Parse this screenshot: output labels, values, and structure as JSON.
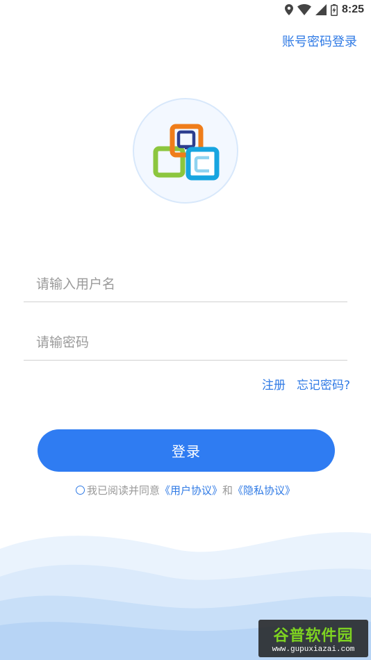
{
  "status_bar": {
    "time": "8:25",
    "icons": [
      "location-icon",
      "wifi-icon",
      "signal-icon",
      "battery-icon"
    ]
  },
  "header": {
    "account_login_label": "账号密码登录"
  },
  "logo": {
    "icon": "app-logo-squares",
    "colors": {
      "orange": "#ef7d1a",
      "green": "#8cc63e",
      "blue": "#17a5e0",
      "navy": "#2c3e8f"
    }
  },
  "form": {
    "username_placeholder": "请输入用户名",
    "password_placeholder": "请输密码",
    "register_label": "注册",
    "forgot_password_label": "忘记密码?",
    "login_button_label": "登录"
  },
  "agreement": {
    "prefix": "我已阅读并同意",
    "user_agreement": "《用户协议》",
    "conjunction": "和",
    "privacy_policy": "《隐私协议》"
  },
  "watermark": {
    "title": "谷普软件园",
    "url": "www.gupuxiazai.com"
  },
  "colors": {
    "accent": "#2f7cf2",
    "link": "#2f7ae5",
    "placeholder": "#9a9a9a"
  }
}
